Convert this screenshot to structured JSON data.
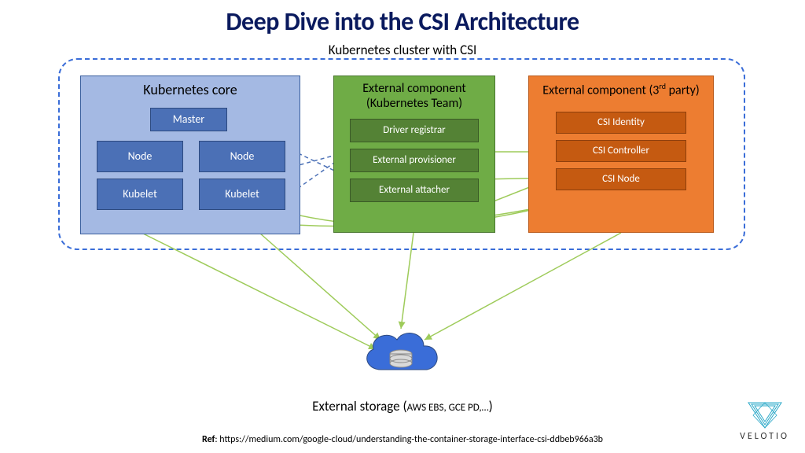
{
  "title": "Deep Dive into the CSI Architecture",
  "cluster_label": "Kubernetes cluster with CSI",
  "k8score": {
    "header": "Kubernetes core",
    "master": "Master",
    "node": "Node",
    "kubelet": "Kubelet"
  },
  "ext_k8s": {
    "header": "External component (Kubernetes Team)",
    "driver_registrar": "Driver registrar",
    "external_provisioner": "External provisioner",
    "external_attacher": "External attacher"
  },
  "ext_3p": {
    "header_prefix": "External component (3",
    "header_suffix": " party)",
    "sup": "rd",
    "csi_identity": "CSI Identity",
    "csi_controller": "CSI Controller",
    "csi_node": "CSI Node"
  },
  "storage": {
    "prefix": "External storage (",
    "examples": "AWS EBS, GCE PD,…",
    "suffix": ")"
  },
  "ref": {
    "label": "Ref",
    "url": ": https://medium.com/google-cloud/understanding-the-container-storage-interface-csi-ddbeb966a3b"
  },
  "logo": "VELOTIO"
}
